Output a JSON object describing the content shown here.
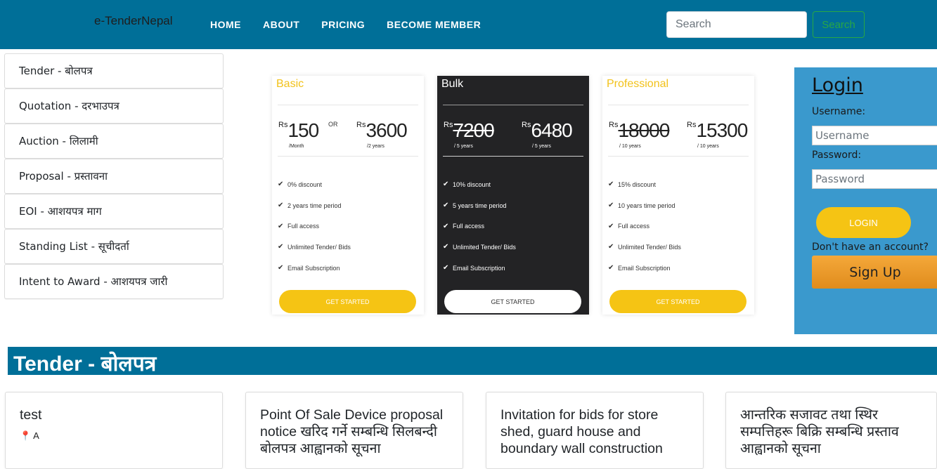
{
  "nav": {
    "brand": "e-TenderNepal",
    "links": [
      "HOME",
      "ABOUT",
      "PRICING",
      "BECOME MEMBER"
    ],
    "search_placeholder": "Search",
    "search_button": "Search"
  },
  "sidebar": {
    "items": [
      {
        "label": "Tender - बोलपत्र"
      },
      {
        "label": "Quotation - दरभाउपत्र"
      },
      {
        "label": "Auction - लिलामी"
      },
      {
        "label": "Proposal - प्रस्तावना"
      },
      {
        "label": "EOI - आशयपत्र माग"
      },
      {
        "label": "Standing List - सूचीदर्ता"
      },
      {
        "label": "Intent to Award - आशयपत्र जारी"
      }
    ]
  },
  "pricing": {
    "or_label": "OR",
    "currency": "Rs",
    "plans": [
      {
        "name": "Basic",
        "price1": "150",
        "price1_period": "/Month",
        "price2": "3600",
        "price2_period": "/2 years",
        "features": [
          "0% discount",
          "2 years time period",
          "Full access",
          " Unlimited Tender/ Bids",
          "Email Subscription"
        ],
        "button": "GET STARTED"
      },
      {
        "name": "Bulk",
        "price1": "7200",
        "price1_period": "/ 5 years",
        "price2": "6480",
        "price2_period": "/ 5 years",
        "features": [
          "10% discount",
          "5 years time period",
          "Full access",
          " Unlimited Tender/ Bids",
          "Email Subscription"
        ],
        "button": "GET STARTED"
      },
      {
        "name": "Professional",
        "price1": "18000",
        "price1_period": "/ 10 years",
        "price2": "15300",
        "price2_period": "/ 10 years",
        "features": [
          "15% discount",
          "10 years time period",
          "Full access",
          " Unlimited Tender/ Bids",
          "Email Subscription"
        ],
        "button": "GET STARTED"
      }
    ]
  },
  "login": {
    "title": "Login",
    "username_label": "Username:",
    "username_placeholder": "Username",
    "password_label": "Password:",
    "password_placeholder": "Password",
    "login_button": "LOGIN",
    "no_account": "Don't have an account?",
    "signup_button": "Sign Up"
  },
  "section": {
    "title": "Tender - बोलपत्र"
  },
  "tenders": [
    {
      "title": "test",
      "location": "A"
    },
    {
      "title": "Point Of Sale Device proposal notice खरिद गर्ने सम्बन्धि सिलबन्दी बोलपत्र आह्वानको सूचना"
    },
    {
      "title": "Invitation for bids for store shed, guard house and boundary wall construction"
    },
    {
      "title": "आन्तरिक सजावट तथा स्थिर सम्पत्तिहरू बिक्रि सम्बन्धि प्रस्ताव आह्वानको सूचना"
    }
  ]
}
